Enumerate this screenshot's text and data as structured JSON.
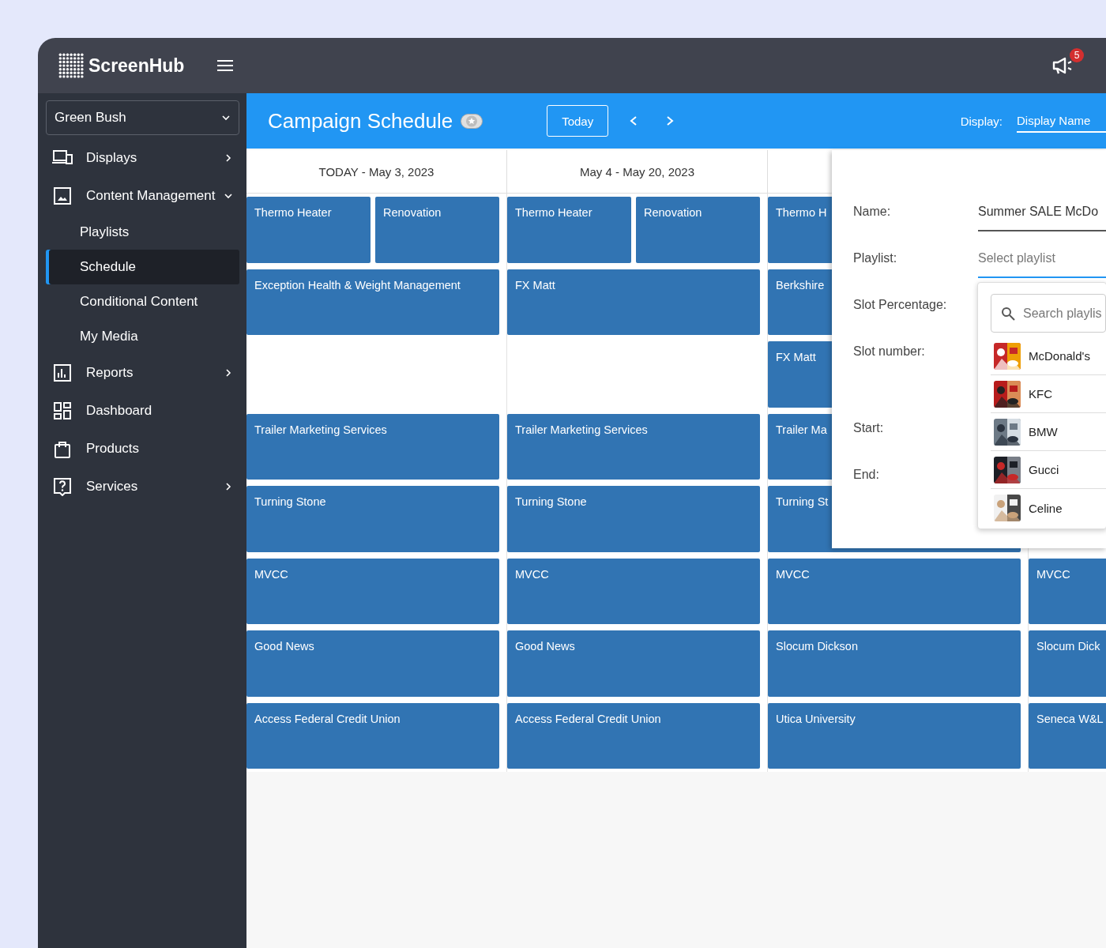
{
  "header": {
    "brand": "ScreenHub",
    "notifications_badge": "5"
  },
  "sidebar": {
    "account": "Green Bush",
    "items": [
      {
        "label": "Displays",
        "kind": "group",
        "expanded": false,
        "selected": false
      },
      {
        "label": "Content Management",
        "kind": "group",
        "expanded": true,
        "selected": false,
        "children": [
          {
            "label": "Playlists",
            "selected": false
          },
          {
            "label": "Schedule",
            "selected": true
          },
          {
            "label": "Conditional Content",
            "selected": false
          },
          {
            "label": "My Media",
            "selected": false
          }
        ]
      },
      {
        "label": "Reports",
        "kind": "group",
        "expanded": false,
        "selected": false
      },
      {
        "label": "Dashboard",
        "kind": "link",
        "selected": false
      },
      {
        "label": "Products",
        "kind": "link",
        "selected": false
      },
      {
        "label": "Services",
        "kind": "group",
        "expanded": false,
        "selected": false
      }
    ]
  },
  "toolbar": {
    "title": "Campaign Schedule",
    "today_button": "Today",
    "display_label": "Display:",
    "display_value": "Display Name"
  },
  "calendar": {
    "columns": [
      {
        "header": "TODAY - May 3, 2023"
      },
      {
        "header": "May 4 - May 20, 2023"
      },
      {},
      {}
    ],
    "rows": [
      {
        "cells": [
          {
            "events": [
              "Thermo Heater",
              "Renovation"
            ]
          },
          {
            "events": [
              "Thermo Heater",
              "Renovation"
            ]
          },
          {
            "events": [
              "Thermo H"
            ]
          },
          {}
        ]
      },
      {
        "cells": [
          {
            "events": [
              "Exception Health & Weight Management"
            ]
          },
          {
            "events": [
              "FX Matt"
            ]
          },
          {
            "events": [
              "Berkshire"
            ]
          },
          {}
        ]
      },
      {
        "cells": [
          {},
          {},
          {
            "events": [
              "FX Matt"
            ]
          },
          {}
        ]
      },
      {
        "cells": [
          {
            "events": [
              "Trailer Marketing Services"
            ]
          },
          {
            "events": [
              "Trailer Marketing Services"
            ]
          },
          {
            "events": [
              "Trailer Ma"
            ]
          },
          {}
        ]
      },
      {
        "cells": [
          {
            "events": [
              "Turning Stone"
            ]
          },
          {
            "events": [
              "Turning Stone"
            ]
          },
          {
            "events": [
              "Turning St"
            ]
          },
          {}
        ]
      },
      {
        "cells": [
          {
            "events": [
              "MVCC"
            ]
          },
          {
            "events": [
              "MVCC"
            ]
          },
          {
            "events": [
              "MVCC"
            ]
          },
          {
            "events": [
              "MVCC"
            ]
          }
        ]
      },
      {
        "cells": [
          {
            "events": [
              "Good News"
            ]
          },
          {
            "events": [
              "Good News"
            ]
          },
          {
            "events": [
              "Slocum Dickson"
            ]
          },
          {
            "events": [
              "Slocum Dick"
            ]
          }
        ]
      },
      {
        "cells": [
          {
            "events": [
              "Access Federal Credit Union"
            ]
          },
          {
            "events": [
              "Access Federal Credit Union"
            ]
          },
          {
            "events": [
              "Utica University"
            ]
          },
          {
            "events": [
              "Seneca W&L"
            ]
          }
        ]
      }
    ]
  },
  "panel": {
    "fields": [
      {
        "label": "Name:",
        "value": "Summer SALE McDo",
        "focused": false
      },
      {
        "label": "Playlist:",
        "placeholder": "Select playlist",
        "focused": true
      },
      {
        "label": "Slot Percentage:"
      },
      {
        "label": "Slot number:"
      },
      {
        "label": "Start:"
      },
      {
        "label": "End:"
      }
    ],
    "dropdown": {
      "search_placeholder": "Search playlis",
      "items": [
        {
          "name": "McDonald's",
          "kind": "picture"
        },
        {
          "name": "KFC",
          "kind": "picture"
        },
        {
          "name": "BMW",
          "kind": "picture"
        },
        {
          "name": "Gucci",
          "kind": "picture"
        },
        {
          "name": "Celine",
          "kind": "picture"
        }
      ]
    }
  }
}
